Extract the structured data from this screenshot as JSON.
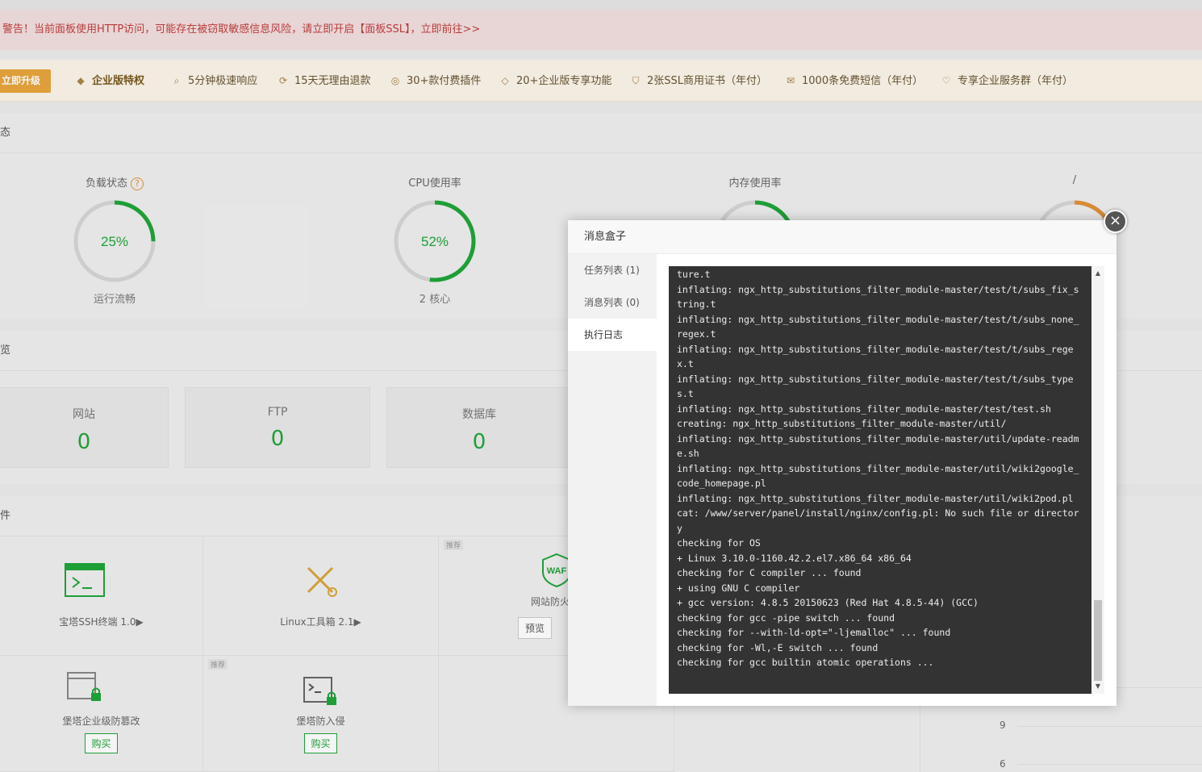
{
  "warning": {
    "text": "警告！当前面板使用HTTP访问，可能存在被窃取敏感信息风险，请立即开启【面板SSL】，",
    "link": "立即前往>>"
  },
  "enterprise": {
    "upgrade_label": "立即升级",
    "title": "企业版特权",
    "features": [
      {
        "icon": "clock-search-icon",
        "label": "5分钟极速响应"
      },
      {
        "icon": "refund-icon",
        "label": "15天无理由退款"
      },
      {
        "icon": "plugin-icon",
        "label": "30+款付费插件"
      },
      {
        "icon": "diamond-icon",
        "label": "20+企业版专享功能"
      },
      {
        "icon": "ssl-shield-icon",
        "label": "2张SSL商用证书（年付）"
      },
      {
        "icon": "mail-icon",
        "label": "1000条免费短信（年付）"
      },
      {
        "icon": "service-heart-icon",
        "label": "专享企业服务群（年付）"
      }
    ]
  },
  "status_section": {
    "title": "态",
    "gauges": [
      {
        "title": "负载状态",
        "value": "25%",
        "percent": 25,
        "sub": "运行流畅"
      },
      {
        "title": "CPU使用率",
        "value": "52%",
        "percent": 52,
        "sub": "2 核心"
      },
      {
        "title": "内存使用率",
        "value": "",
        "percent": 40,
        "sub": ""
      },
      {
        "title": "/",
        "value": "",
        "percent": 60,
        "sub": ""
      }
    ],
    "colors": {
      "ok": "#20a53a",
      "warn": "#e0923a",
      "track": "#d6d6d6"
    }
  },
  "overview_section": {
    "title": "览",
    "cards": [
      {
        "label": "网站",
        "value": "0"
      },
      {
        "label": "FTP",
        "value": "0"
      },
      {
        "label": "数据库",
        "value": "0"
      }
    ]
  },
  "software_section": {
    "title": "件",
    "tag": "推荐",
    "items": [
      {
        "name": "宝塔SSH终端 1.0▶"
      },
      {
        "name": "Linux工具箱 2.1▶"
      },
      {
        "name": "网站防火"
      },
      {
        "name": "堡塔企业级防篡改",
        "button": "购买"
      },
      {
        "name": "堡塔防入侵",
        "button": "购买"
      }
    ],
    "preview_label": "预览",
    "waf_text": "WAF"
  },
  "chart_axis": {
    "ticks": [
      "9",
      "6"
    ]
  },
  "modal": {
    "title": "消息盒子",
    "tabs": [
      {
        "label": "任务列表 (1)"
      },
      {
        "label": "消息列表 (0)"
      },
      {
        "label": "执行日志"
      }
    ],
    "close_symbol": "×",
    "log_text": "ture.t\ninflating: ngx_http_substitutions_filter_module-master/test/t/subs_fix_string.t\ninflating: ngx_http_substitutions_filter_module-master/test/t/subs_none_regex.t\ninflating: ngx_http_substitutions_filter_module-master/test/t/subs_regex.t\ninflating: ngx_http_substitutions_filter_module-master/test/t/subs_types.t\ninflating: ngx_http_substitutions_filter_module-master/test/test.sh\ncreating: ngx_http_substitutions_filter_module-master/util/\ninflating: ngx_http_substitutions_filter_module-master/util/update-readme.sh\ninflating: ngx_http_substitutions_filter_module-master/util/wiki2google_code_homepage.pl\ninflating: ngx_http_substitutions_filter_module-master/util/wiki2pod.pl\ncat: /www/server/panel/install/nginx/config.pl: No such file or directory\nchecking for OS\n+ Linux 3.10.0-1160.42.2.el7.x86_64 x86_64\nchecking for C compiler ... found\n+ using GNU C compiler\n+ gcc version: 4.8.5 20150623 (Red Hat 4.8.5-44) (GCC)\nchecking for gcc -pipe switch ... found\nchecking for --with-ld-opt=\"-ljemalloc\" ... found\nchecking for -Wl,-E switch ... found\nchecking for gcc builtin atomic operations ..."
  }
}
